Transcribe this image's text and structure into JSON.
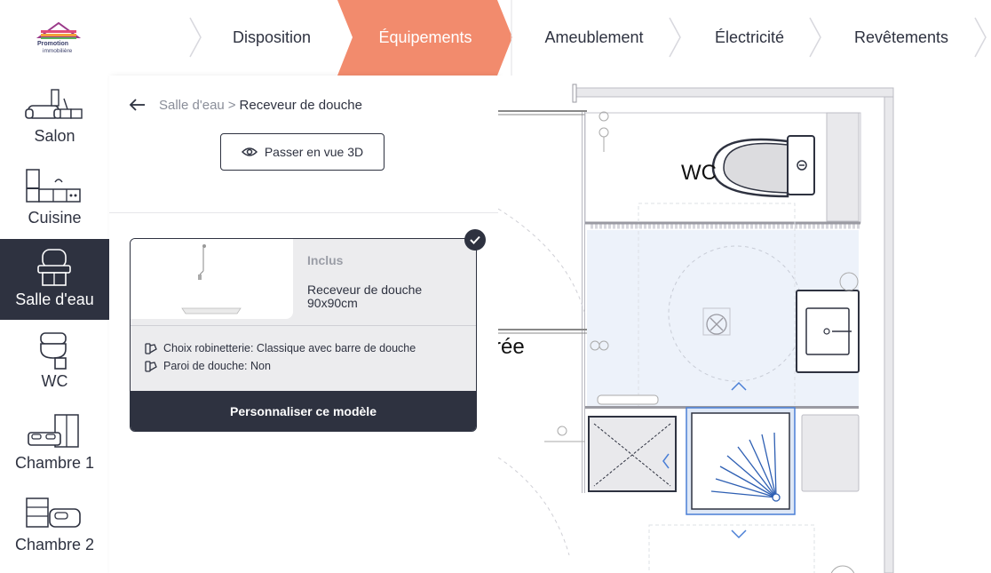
{
  "brand": {
    "logo_line1": "Promotion",
    "logo_line2": "immobilière"
  },
  "steps": [
    {
      "label": "Disposition",
      "active": false
    },
    {
      "label": "Équipements",
      "active": true
    },
    {
      "label": "Ameublement",
      "active": false
    },
    {
      "label": "Électricité",
      "active": false
    },
    {
      "label": "Revêtements",
      "active": false
    }
  ],
  "colors": {
    "accent": "#f28b6d",
    "dark": "#2e3240",
    "plan_highlight": "#edf2fa",
    "plan_selected": "#4a7fd6"
  },
  "rooms": [
    {
      "label": "Salon",
      "icon": "sofa-icon",
      "active": false
    },
    {
      "label": "Cuisine",
      "icon": "kitchen-icon",
      "active": false
    },
    {
      "label": "Salle d'eau",
      "icon": "bathroom-sink-icon",
      "active": true
    },
    {
      "label": "WC",
      "icon": "toilet-icon",
      "active": false
    },
    {
      "label": "Chambre 1",
      "icon": "bed-wardrobe-icon",
      "active": false
    },
    {
      "label": "Chambre 2",
      "icon": "bed-drawer-icon",
      "active": false
    }
  ],
  "panel": {
    "breadcrumb": {
      "parent": "Salle d'eau",
      "separator": ">",
      "current": "Receveur de douche"
    },
    "view3d_label": "Passer en vue 3D",
    "card": {
      "status": "Inclus",
      "product_name": "Receveur de douche 90x90cm",
      "options": [
        "Choix robinetterie: Classique avec barre de douche",
        "Paroi de douche: Non"
      ],
      "customize_label": "Personnaliser ce modèle",
      "selected": true
    }
  },
  "plan": {
    "labels": {
      "wc": "WC",
      "entry_fragment": "rée"
    }
  }
}
